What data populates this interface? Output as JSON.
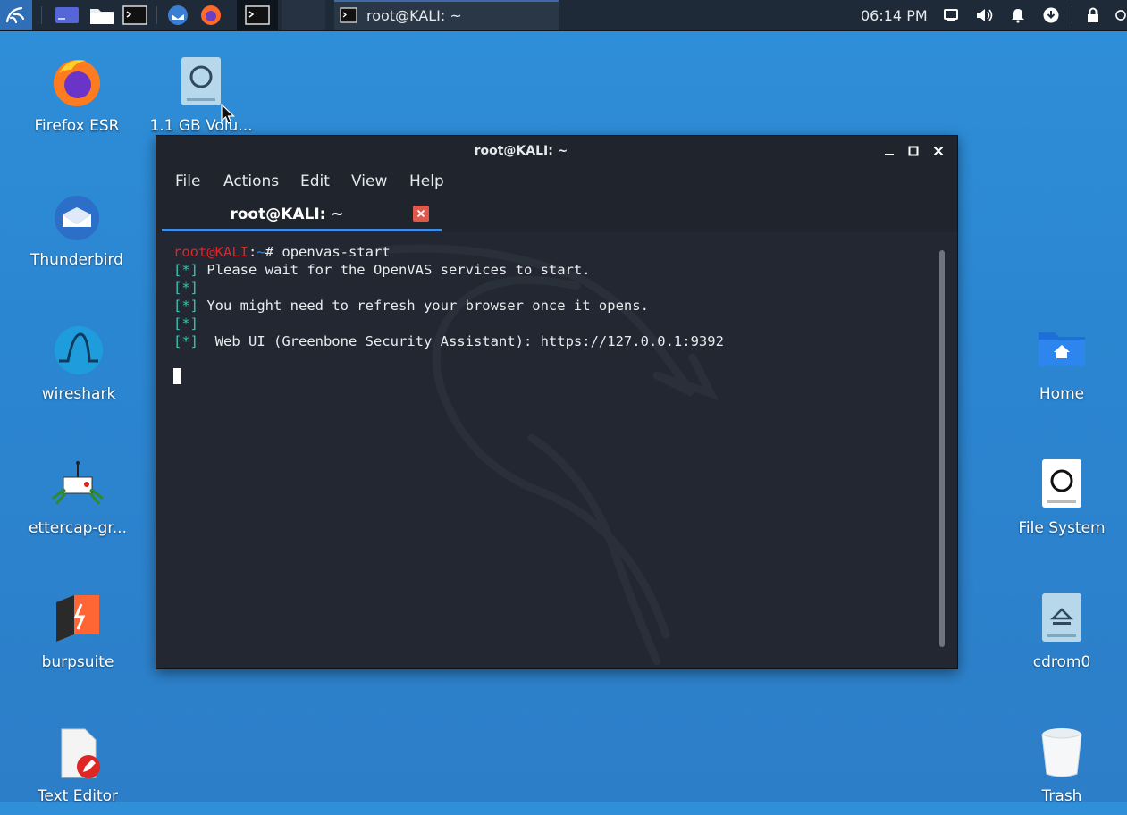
{
  "panel": {
    "task_label": "root@KALI: ~",
    "clock": "06:14 PM"
  },
  "desktop_left": [
    {
      "label": "Firefox ESR"
    },
    {
      "label": "Thunderbird"
    },
    {
      "label": "wireshark"
    },
    {
      "label": "ettercap-gr..."
    },
    {
      "label": "burpsuite"
    },
    {
      "label": "Text Editor"
    }
  ],
  "desktop_volume": {
    "label": "1.1 GB Volu..."
  },
  "desktop_right": [
    {
      "label": "Home"
    },
    {
      "label": "File System"
    },
    {
      "label": "cdrom0"
    },
    {
      "label": "Trash"
    }
  ],
  "window": {
    "title": "root@KALI: ~",
    "menu": [
      "File",
      "Actions",
      "Edit",
      "View",
      "Help"
    ],
    "tab_label": "root@KALI: ~",
    "prompt_user": "root@KALI",
    "prompt_sep": ":",
    "prompt_path": "~",
    "prompt_symbol": "# ",
    "command": "openvas-start",
    "marker": "[*]",
    "lines": [
      " Please wait for the OpenVAS services to start.",
      "",
      " You might need to refresh your browser once it opens.",
      "",
      "  Web UI (Greenbone Security Assistant): https://127.0.0.1:9392"
    ]
  },
  "colors": {
    "desktop_bg": "#2d86d0",
    "prompt_red": "#e0242b",
    "marker_cyan": "#3ec0b0",
    "tab_underline": "#3d8ee6"
  }
}
